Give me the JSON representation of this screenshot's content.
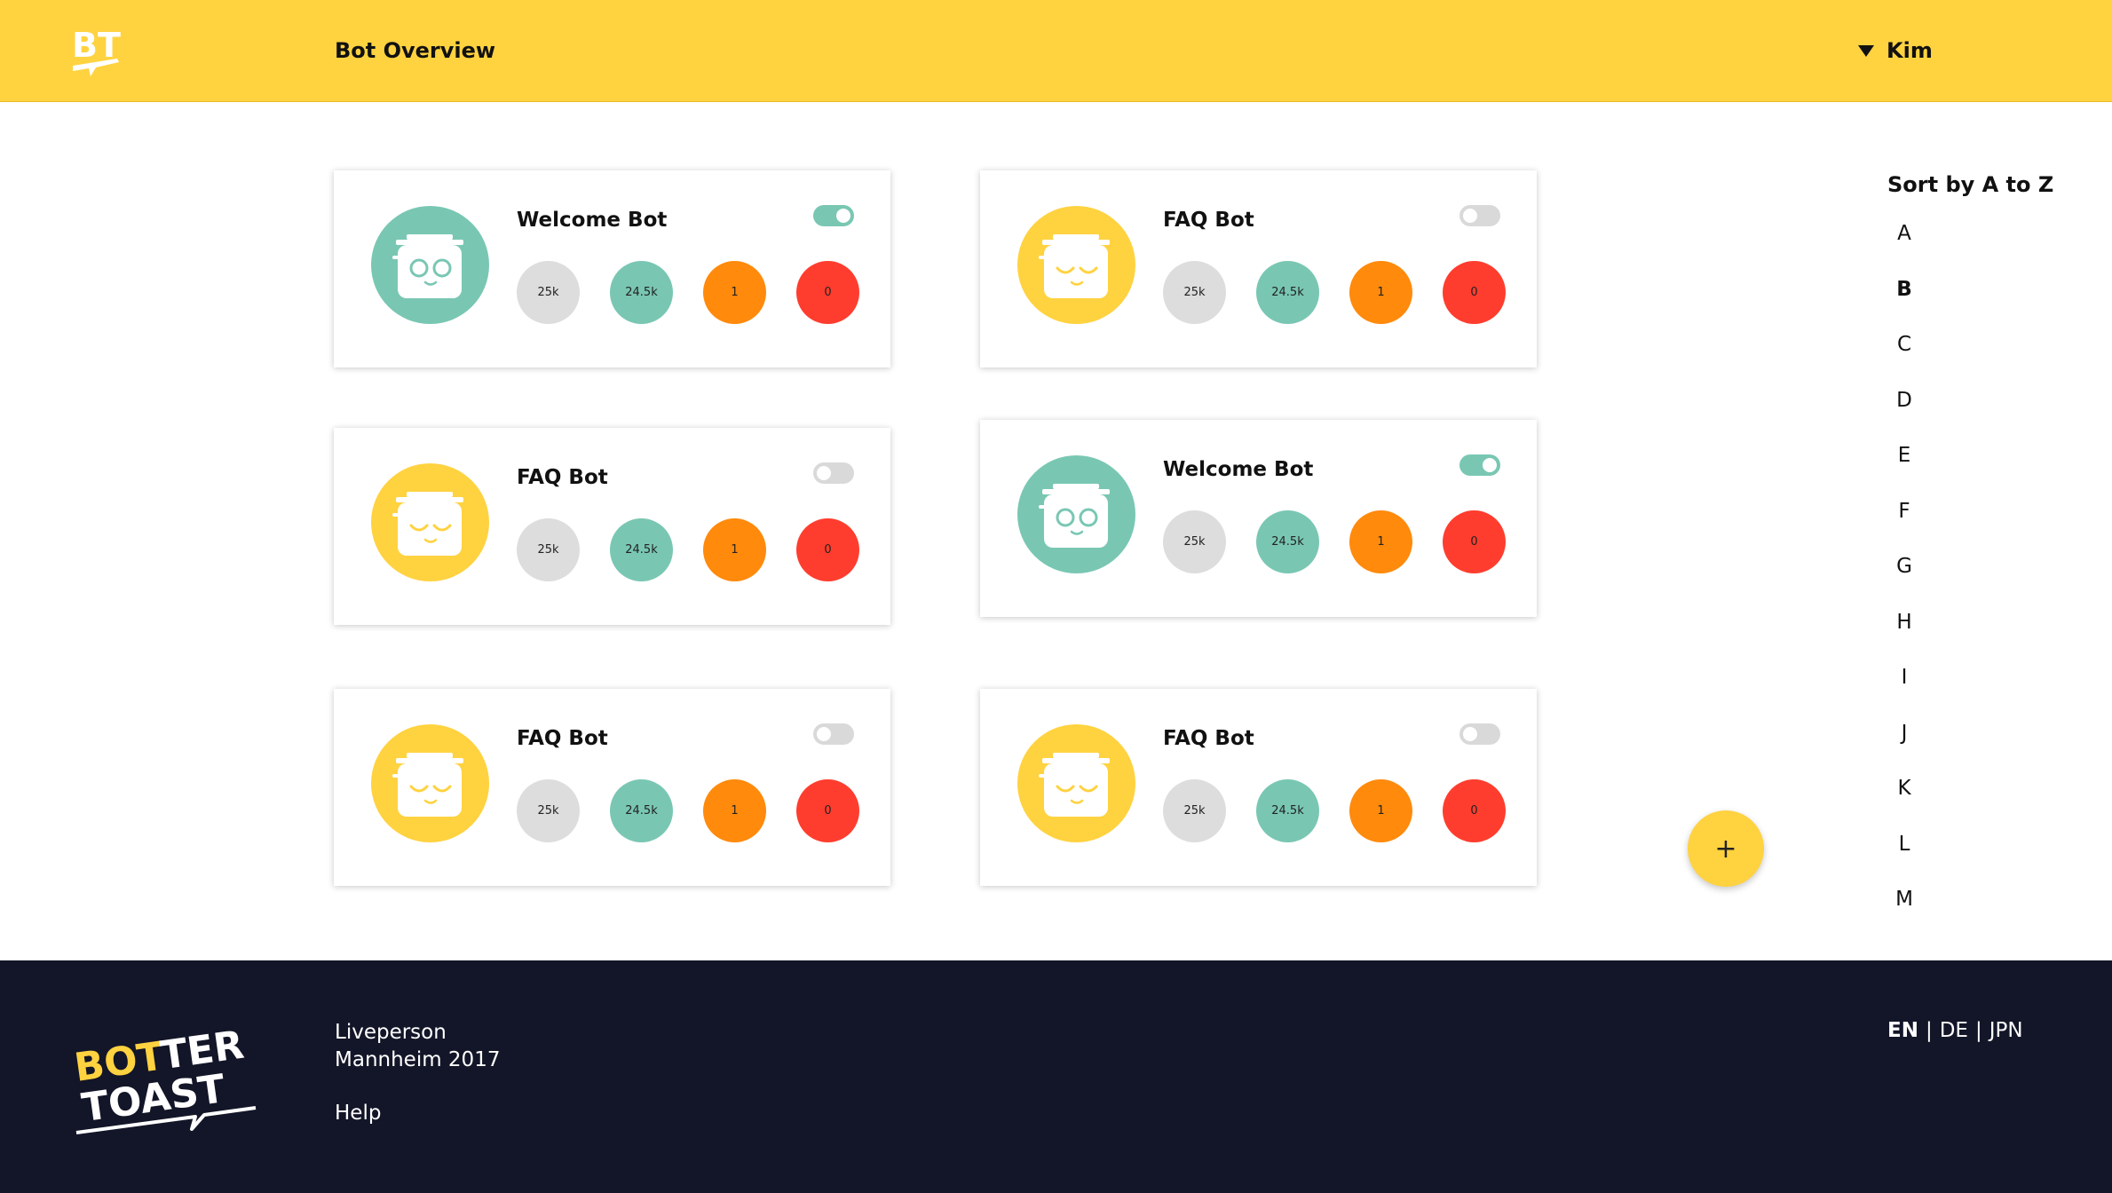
{
  "header": {
    "logo_text": "BT",
    "title": "Bot Overview",
    "user_name": "Kim",
    "user_menu_icon": "caret-down-icon"
  },
  "colors": {
    "brand_yellow": "#ffd240",
    "teal": "#79c7b3",
    "gray": "#dddddd",
    "orange": "#ff8a0c",
    "red": "#ff3d2e",
    "footer_bg": "#131628"
  },
  "bots": [
    {
      "name": "Welcome Bot",
      "avatar": "teal",
      "face": "open-eyes",
      "enabled": true,
      "stats": [
        "25k",
        "24.5k",
        "1",
        "0"
      ]
    },
    {
      "name": "FAQ Bot",
      "avatar": "yellow",
      "face": "sleepy-eyes",
      "enabled": false,
      "stats": [
        "25k",
        "24.5k",
        "1",
        "0"
      ]
    },
    {
      "name": "FAQ Bot",
      "avatar": "yellow",
      "face": "sleepy-eyes",
      "enabled": false,
      "stats": [
        "25k",
        "24.5k",
        "1",
        "0"
      ]
    },
    {
      "name": "Welcome Bot",
      "avatar": "teal",
      "face": "open-eyes",
      "enabled": true,
      "stats": [
        "25k",
        "24.5k",
        "1",
        "0"
      ]
    },
    {
      "name": "FAQ Bot",
      "avatar": "yellow",
      "face": "sleepy-eyes",
      "enabled": false,
      "stats": [
        "25k",
        "24.5k",
        "1",
        "0"
      ]
    },
    {
      "name": "FAQ Bot",
      "avatar": "yellow",
      "face": "sleepy-eyes",
      "enabled": false,
      "stats": [
        "25k",
        "24.5k",
        "1",
        "0"
      ]
    }
  ],
  "sort": {
    "title": "Sort by A to Z",
    "letters": [
      "A",
      "B",
      "C",
      "D",
      "E",
      "F",
      "G",
      "H",
      "I",
      "J",
      "K",
      "L",
      "M"
    ],
    "active": "B"
  },
  "fab": {
    "label": "+",
    "icon": "plus-icon"
  },
  "footer": {
    "logo_line1_a": "BOT",
    "logo_line1_b": "TER",
    "logo_line2": "TOAST",
    "company": "Liveperson",
    "location": "Mannheim 2017",
    "help": "Help",
    "languages": [
      "EN",
      "DE",
      "JPN"
    ],
    "active_language": "EN",
    "separator": "|"
  }
}
